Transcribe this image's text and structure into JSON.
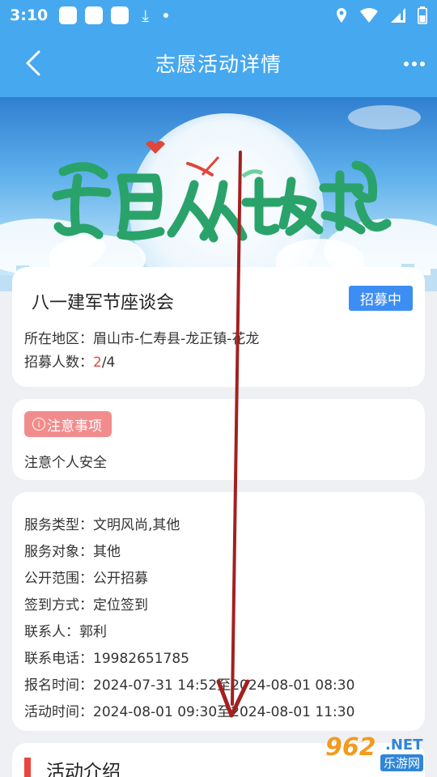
{
  "status_bar": {
    "time": "3:10"
  },
  "header": {
    "title": "志愿活动详情"
  },
  "activity": {
    "title": "八一建军节座谈会",
    "status": "招募中",
    "location_label": "所在地区：",
    "location_value": "眉山市-仁寿县-龙正镇-花龙",
    "recruit_label": "招募人数：",
    "recruit_current": "2",
    "recruit_total": "/4"
  },
  "notice": {
    "tag": "注意事项",
    "text": "注意个人安全"
  },
  "details": [
    {
      "label": "服务类型：",
      "value": "文明风尚,其他"
    },
    {
      "label": "服务对象：",
      "value": "其他"
    },
    {
      "label": "公开范围：",
      "value": "公开招募"
    },
    {
      "label": "签到方式：",
      "value": "定位签到"
    },
    {
      "label": "联系人：",
      "value": "郭利"
    },
    {
      "label": "联系电话：",
      "value": "19982651785"
    },
    {
      "label": "报名时间：",
      "value": "2024-07-31 14:52至2024-08-01 08:30"
    },
    {
      "label": "活动时间：",
      "value": "2024-08-01 09:30至2024-08-01 11:30"
    }
  ],
  "intro_section": {
    "title": "活动介绍"
  },
  "watermark": {
    "number": "962",
    "domain": ".NET",
    "sub": "乐游网"
  },
  "colors": {
    "primary": "#46a8ef",
    "badge": "#3d8ef2",
    "accent_red": "#e8473f",
    "notice_tag": "#f28c8c",
    "annotation_arrow": "#a32020"
  }
}
